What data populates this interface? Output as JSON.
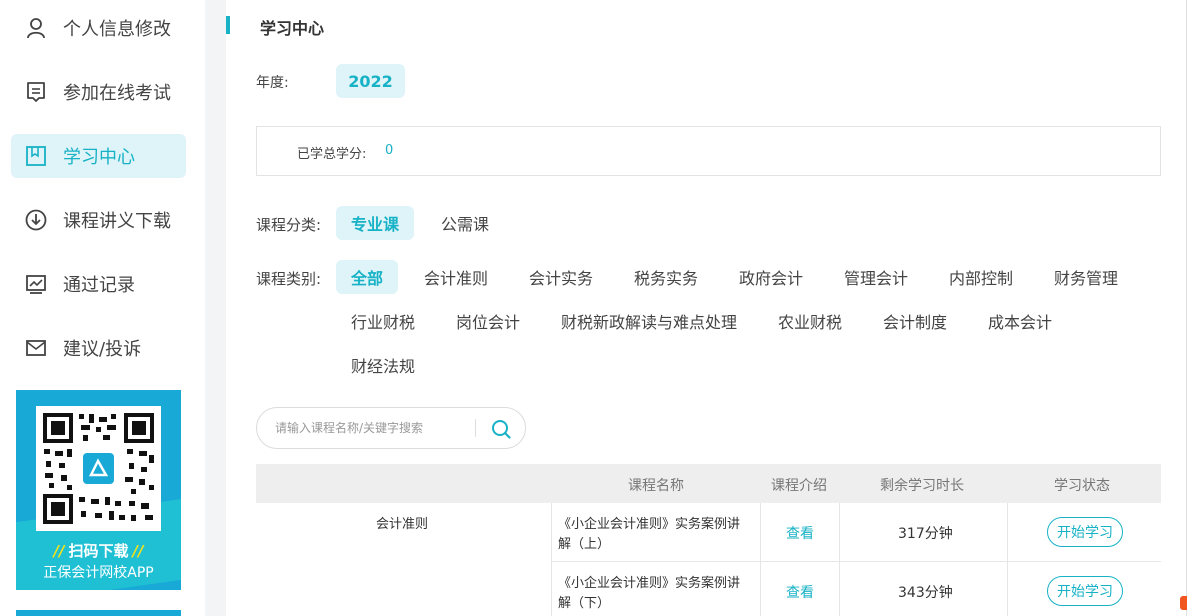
{
  "sidebar": {
    "items": [
      {
        "label": "个人信息修改",
        "icon": "user-icon"
      },
      {
        "label": "参加在线考试",
        "icon": "exam-icon"
      },
      {
        "label": "学习中心",
        "icon": "bookmark-icon",
        "active": true
      },
      {
        "label": "课程讲义下载",
        "icon": "download-icon"
      },
      {
        "label": "通过记录",
        "icon": "chart-icon"
      },
      {
        "label": "建议/投诉",
        "icon": "mail-icon"
      }
    ],
    "qr": {
      "download_label": "扫码下载",
      "app_name": "正保会计网校APP"
    }
  },
  "main": {
    "title": "学习中心",
    "year_label": "年度:",
    "year_value": "2022",
    "credit_label": "已学总学分:",
    "credit_value": "0",
    "category_label": "课程分类:",
    "categories": [
      "专业课",
      "公需课"
    ],
    "type_label": "课程类别:",
    "types": [
      "全部",
      "会计准则",
      "会计实务",
      "税务实务",
      "政府会计",
      "管理会计",
      "内部控制",
      "财务管理",
      "行业财税",
      "岗位会计",
      "财税新政解读与难点处理",
      "农业财税",
      "会计制度",
      "成本会计",
      "财经法规"
    ],
    "search_placeholder": "请输入课程名称/关键字搜索",
    "table": {
      "headers": [
        "课程名称",
        "课程介绍",
        "剩余学习时长",
        "学习状态"
      ],
      "group": "会计准则",
      "rows": [
        {
          "name_line1": "《小企业会计准则》实务案例讲",
          "name_line2": "解（上）",
          "intro": "查看",
          "remaining": "317分钟",
          "status": "开始学习"
        },
        {
          "name_line1": "《小企业会计准则》实务案例讲",
          "name_line2": "解（下）",
          "intro": "查看",
          "remaining": "343分钟",
          "status": "开始学习"
        }
      ]
    }
  },
  "colors": {
    "accent": "#17b2c6",
    "accent_bg": "#dff4f8",
    "qr_bg": "#18a9d6"
  }
}
